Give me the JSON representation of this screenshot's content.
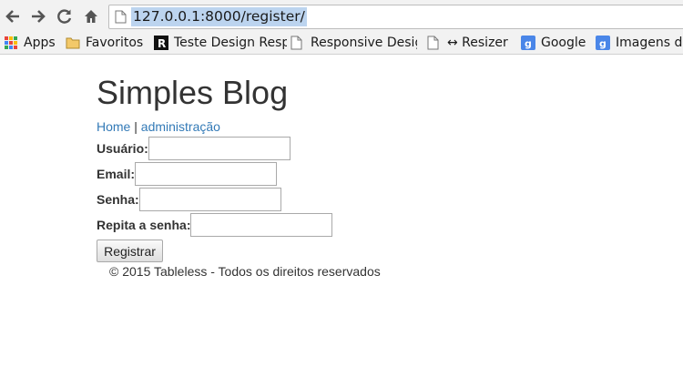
{
  "browser": {
    "url": "127.0.0.1:8000/register/",
    "bookmarks": [
      {
        "label": "Apps",
        "icon": "apps-grid-icon"
      },
      {
        "label": "Favoritos",
        "icon": "folder-icon"
      },
      {
        "label": "Teste Design Resp",
        "icon": "r-logo-icon"
      },
      {
        "label": "Responsive Desig",
        "icon": "page-icon"
      },
      {
        "label": "↔ Resizer",
        "icon": "page-icon"
      },
      {
        "label": "Google",
        "icon": "google-icon"
      },
      {
        "label": "Imagens do",
        "icon": "google-icon"
      }
    ],
    "colors": {
      "link": "#337ab7",
      "url_highlight": "#bcd4ef",
      "google_blue": "#4a86e8"
    }
  },
  "page": {
    "title": "Simples Blog",
    "nav": {
      "home": "Home",
      "separator": "|",
      "admin": "administração"
    },
    "form": {
      "username_label": "Usuário:",
      "username_value": "",
      "email_label": "Email:",
      "email_value": "",
      "password_label": "Senha:",
      "password_value": "",
      "password_repeat_label": "Repita a senha:",
      "password_repeat_value": "",
      "submit_label": "Registrar"
    },
    "footer": "© 2015 Tableless - Todos os direitos reservados"
  }
}
